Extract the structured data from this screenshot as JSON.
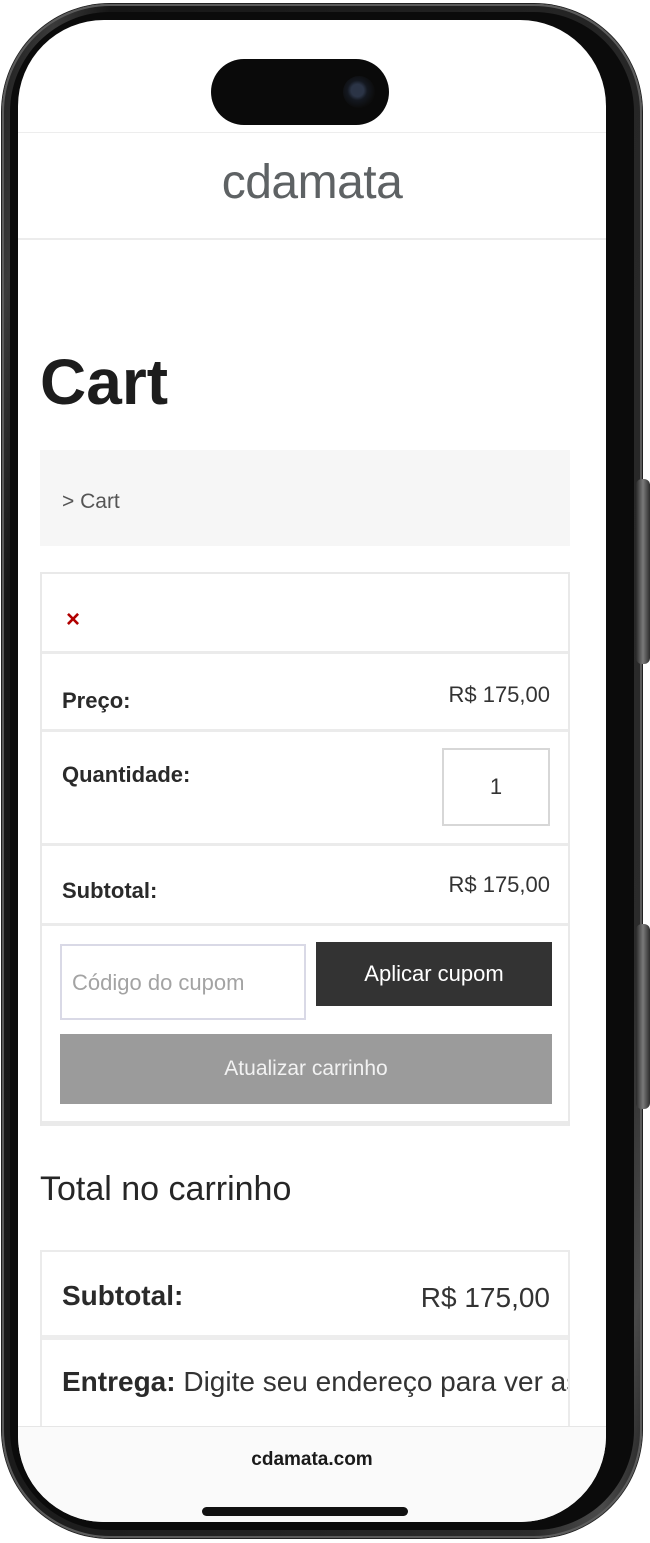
{
  "header": {
    "logo_text": "cdamata"
  },
  "page": {
    "title": "Cart"
  },
  "breadcrumb": {
    "text": "> Cart"
  },
  "cart": {
    "remove_icon": "×",
    "price": {
      "label": "Preço:",
      "value": "R$ 175,00"
    },
    "quantity": {
      "label": "Quantidade:",
      "value": "1"
    },
    "subtotal": {
      "label": "Subtotal:",
      "value": "R$ 175,00"
    },
    "coupon": {
      "placeholder": "Código do cupom",
      "apply_label": "Aplicar cupom"
    },
    "update_label": "Atualizar carrinho"
  },
  "totals": {
    "title": "Total no carrinho",
    "subtotal_label": "Subtotal:",
    "subtotal_value": "R$ 175,00",
    "shipping_label": "Entrega:",
    "shipping_text": " Digite seu endereço para ver as"
  },
  "browser": {
    "url": "cdamata.com"
  },
  "colors": {
    "remove": "#b10000",
    "apply_button": "#333333",
    "update_button": "#9b9b9b"
  },
  "icons": {
    "remove": "close-icon"
  }
}
